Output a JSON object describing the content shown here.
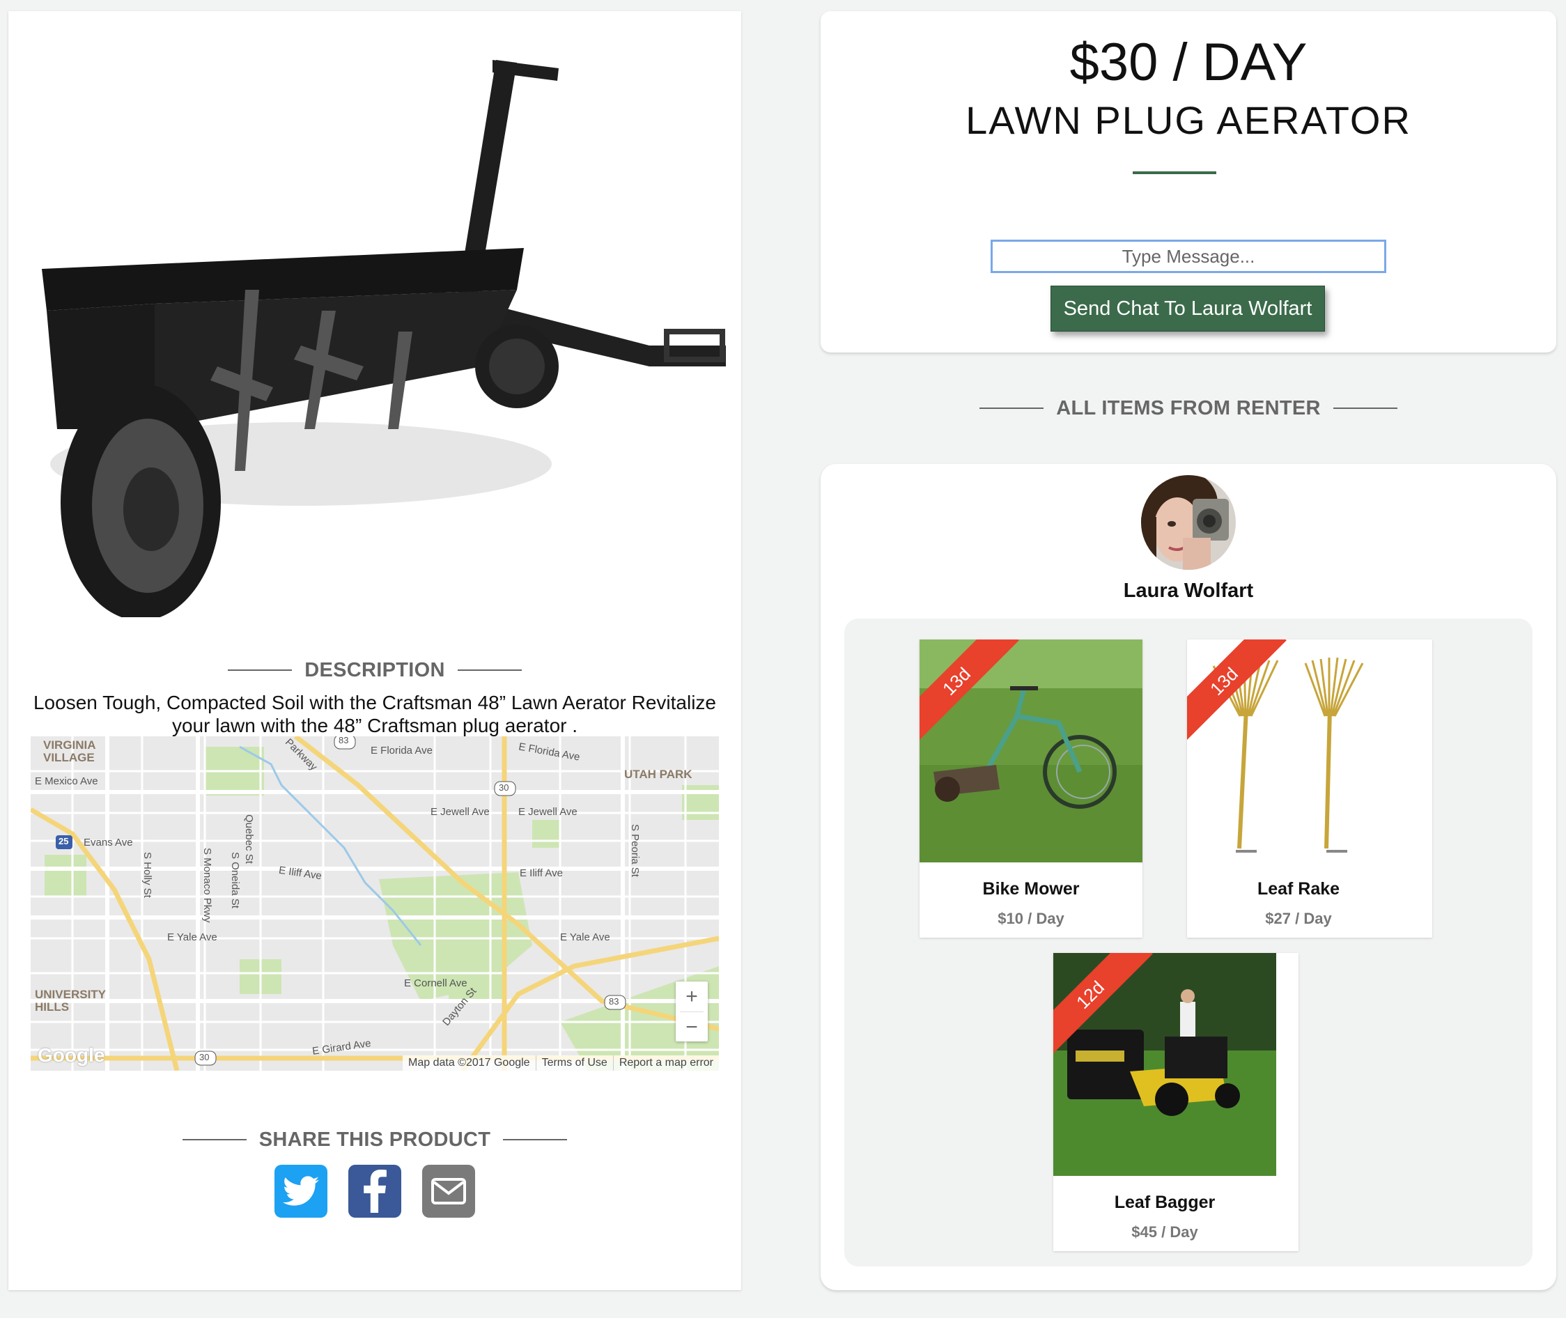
{
  "product": {
    "price": "$30 / DAY",
    "title": "LAWN PLUG AERATOR",
    "image_icon": "lawn-aerator-photo"
  },
  "description": {
    "heading": "DESCRIPTION",
    "text": "Loosen Tough, Compacted Soil with the Craftsman 48” Lawn Aerator Revitalize your lawn with the 48” Craftsman plug aerator ."
  },
  "map": {
    "labels": {
      "virginia": "VIRGINIA\nVILLAGE",
      "mexico": "E Mexico Ave",
      "florida1": "E Florida Ave",
      "florida2": "E Florida Ave",
      "utah": "UTAH PARK",
      "jewell1": "E Jewell Ave",
      "jewell2": "E Jewell Ave",
      "evans": "Evans Ave",
      "iliff1": "E Iliff Ave",
      "iliff2": "E Iliff Ave",
      "yale1": "E Yale Ave",
      "yale2": "E Yale Ave",
      "cornell": "E Cornell Ave",
      "girard": "E Girard Ave",
      "university": "UNIVERSITY\nHILLS",
      "quebec": "Quebec St",
      "holly": "S Holly St",
      "monaco": "S Monaco Pkwy",
      "oneida": "S Oneida St",
      "peoria": "S Peoria St",
      "dayton": "Dayton St",
      "parkway": "Parkway",
      "route83a": "83",
      "route30a": "30",
      "route25": "25",
      "route83b": "83",
      "route30b": "30"
    },
    "zoom_in": "+",
    "zoom_out": "−",
    "brand": "Google",
    "footer": {
      "data": "Map data ©2017 Google",
      "terms": "Terms of Use",
      "report": "Report a map error"
    }
  },
  "share": {
    "heading": "SHARE THIS PRODUCT",
    "buttons": [
      "twitter-icon",
      "facebook-icon",
      "email-icon"
    ]
  },
  "chat": {
    "placeholder": "Type Message...",
    "send_label": "Send Chat To Laura Wolfart"
  },
  "renter": {
    "section_heading": "ALL ITEMS FROM RENTER",
    "name": "Laura Wolfart",
    "items": [
      {
        "name": "Bike Mower",
        "price": "$10 / Day",
        "age": "13d"
      },
      {
        "name": "Leaf Rake",
        "price": "$27 / Day",
        "age": "13d"
      },
      {
        "name": "Leaf Bagger",
        "price": "$45 / Day",
        "age": "12d"
      }
    ]
  },
  "colors": {
    "accent_green": "#3b6b4b",
    "ribbon_red": "#e8412c",
    "twitter": "#1da1f2",
    "facebook": "#3b5998",
    "email": "#7a7a7a"
  }
}
